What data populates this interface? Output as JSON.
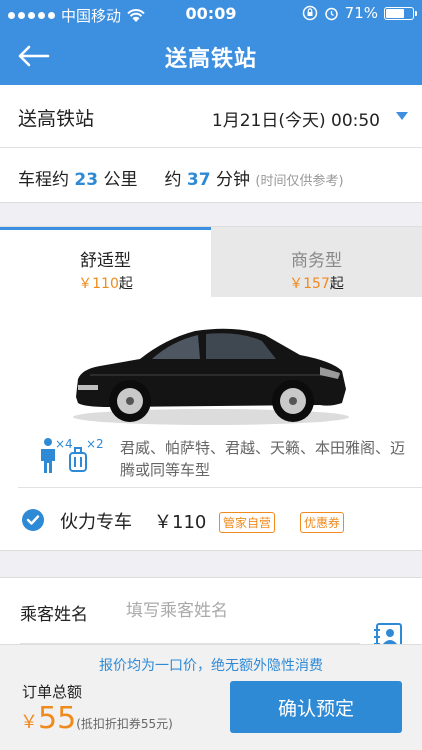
{
  "status_bar": {
    "carrier": "中国移动",
    "time": "00:09",
    "battery": "71%",
    "battery_level": 0.71
  },
  "nav": {
    "title": "送高铁站"
  },
  "trip": {
    "station_label": "送高铁站",
    "datetime": "1月21日(今天) 00:50",
    "distance_prefix": "车程约",
    "distance": "23",
    "distance_unit": "公里",
    "duration_prefix": "约",
    "duration": "37",
    "duration_unit": "分钟",
    "note": "(时间仅供参考)"
  },
  "car_types": [
    {
      "name": "舒适型",
      "currency": "￥",
      "price": "110",
      "suffix": "起"
    },
    {
      "name": "商务型",
      "currency": "￥",
      "price": "157",
      "suffix": "起"
    }
  ],
  "capacity": {
    "passengers": "×4",
    "luggage": "×2"
  },
  "models_text": "君威、帕萨特、君越、天籁、本田雅阁、迈腾或同等车型",
  "service": {
    "name": "伙力专车",
    "price": "￥110",
    "tags": [
      "管家自营",
      "优惠券"
    ]
  },
  "passenger": {
    "label": "乘客姓名",
    "placeholder": "填写乘客姓名",
    "value": ""
  },
  "footer": {
    "notice": "报价均为一口价，绝无额外隐性消费",
    "total_label": "订单总额",
    "currency": "￥",
    "amount": "55",
    "discount_note": "(抵扣折扣券55元)",
    "confirm_label": "确认预定"
  },
  "colors": {
    "primary": "#3d8fe0",
    "accent": "#f08a1d"
  }
}
